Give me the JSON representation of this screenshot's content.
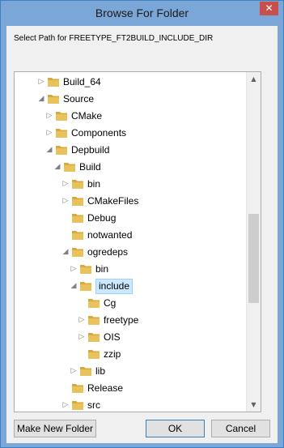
{
  "window": {
    "title": "Browse For Folder",
    "close_glyph": "✕"
  },
  "prompt": "Select Path for FREETYPE_FT2BUILD_INCLUDE_DIR",
  "tree": {
    "items": [
      {
        "label": "Build_64",
        "depth": 3,
        "expander": "collapsed"
      },
      {
        "label": "Source",
        "depth": 3,
        "expander": "expanded"
      },
      {
        "label": "CMake",
        "depth": 4,
        "expander": "collapsed"
      },
      {
        "label": "Components",
        "depth": 4,
        "expander": "collapsed"
      },
      {
        "label": "Depbuild",
        "depth": 4,
        "expander": "expanded"
      },
      {
        "label": "Build",
        "depth": 5,
        "expander": "expanded"
      },
      {
        "label": "bin",
        "depth": 6,
        "expander": "collapsed"
      },
      {
        "label": "CMakeFiles",
        "depth": 6,
        "expander": "collapsed"
      },
      {
        "label": "Debug",
        "depth": 6,
        "expander": "none"
      },
      {
        "label": "notwanted",
        "depth": 6,
        "expander": "none"
      },
      {
        "label": "ogredeps",
        "depth": 6,
        "expander": "expanded"
      },
      {
        "label": "bin",
        "depth": 7,
        "expander": "collapsed"
      },
      {
        "label": "include",
        "depth": 7,
        "expander": "expanded",
        "selected": true
      },
      {
        "label": "Cg",
        "depth": 8,
        "expander": "none"
      },
      {
        "label": "freetype",
        "depth": 8,
        "expander": "collapsed"
      },
      {
        "label": "OIS",
        "depth": 8,
        "expander": "collapsed"
      },
      {
        "label": "zzip",
        "depth": 8,
        "expander": "none"
      },
      {
        "label": "lib",
        "depth": 7,
        "expander": "collapsed"
      },
      {
        "label": "Release",
        "depth": 6,
        "expander": "none"
      },
      {
        "label": "src",
        "depth": 6,
        "expander": "collapsed"
      }
    ]
  },
  "buttons": {
    "make_new_folder": "Make New Folder",
    "ok": "OK",
    "cancel": "Cancel"
  },
  "colors": {
    "folder": "#e8c25a",
    "selection": "#cce8ff",
    "titlebar": "#7aa6d8"
  }
}
